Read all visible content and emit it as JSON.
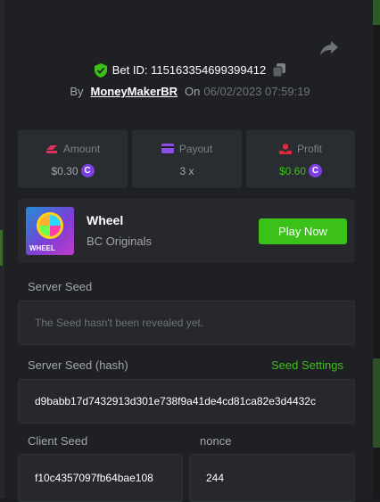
{
  "bet": {
    "id_label": "Bet ID: 115163354699399412",
    "by_label": "By",
    "username": "MoneyMakerBR",
    "on_label": "On",
    "date": "06/02/2023 07:59:19"
  },
  "stats": {
    "amount": {
      "label": "Amount",
      "value": "$0.30"
    },
    "payout": {
      "label": "Payout",
      "value": "3 x"
    },
    "profit": {
      "label": "Profit",
      "value": "$0.60"
    }
  },
  "game": {
    "thumb_text": "WHEEL",
    "name": "Wheel",
    "provider": "BC Originals",
    "play_label": "Play Now"
  },
  "server_seed": {
    "label": "Server Seed",
    "value": "The Seed hasn't been revealed yet."
  },
  "server_seed_hash": {
    "label": "Server Seed (hash)",
    "settings_label": "Seed Settings",
    "value": "d9babb17d7432913d301e738f9a41de4cd81ca82e3d4432c"
  },
  "client_seed": {
    "label": "Client Seed",
    "value": "f10c4357097fb64bae108"
  },
  "nonce": {
    "label": "nonce",
    "value": "244"
  },
  "colors": {
    "accent_green": "#3bc117",
    "coin_purple": "#7b3fe4",
    "amount_icon": "#e0315c",
    "payout_icon": "#8b4fe8",
    "profit_icon": "#e02b3b"
  }
}
